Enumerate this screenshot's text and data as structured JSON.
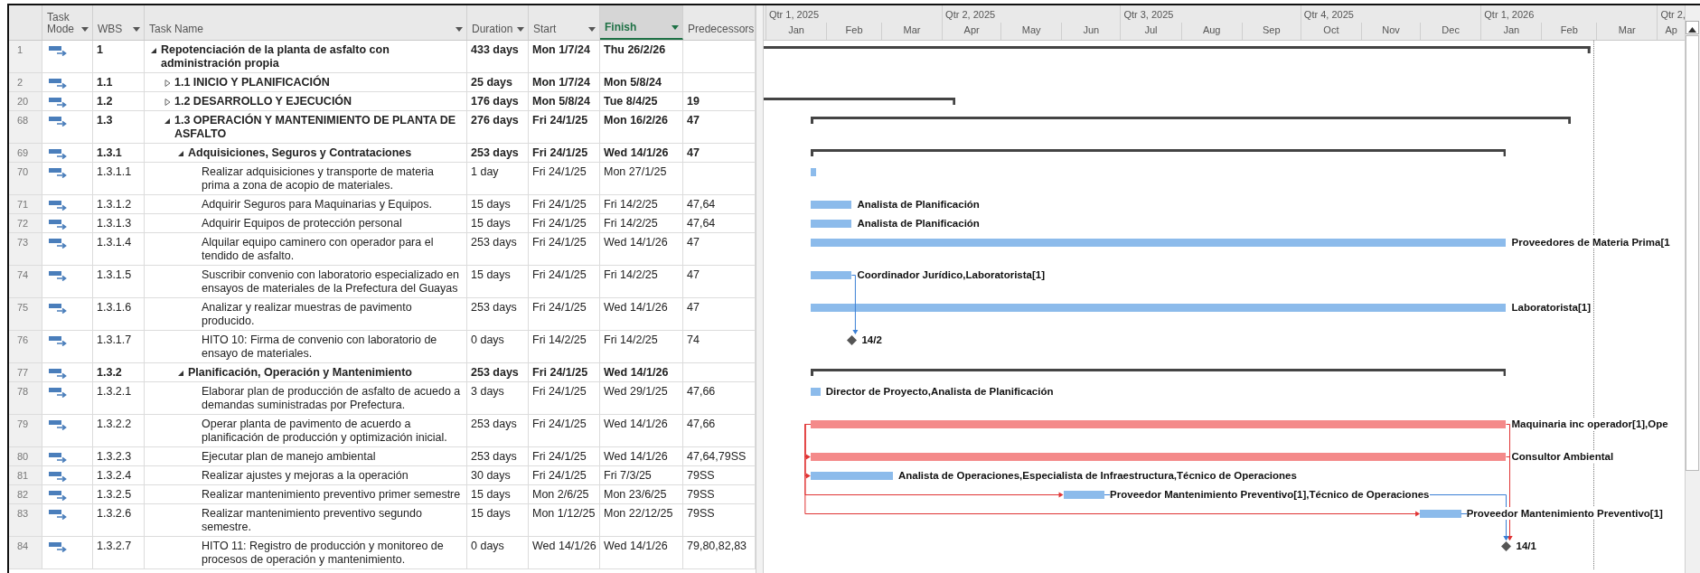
{
  "header": {
    "columns": [
      {
        "label": "Task Mode",
        "has_menu": true,
        "selected": false
      },
      {
        "label": "WBS",
        "has_menu": true,
        "selected": false
      },
      {
        "label": "Task Name",
        "has_menu": true,
        "selected": false
      },
      {
        "label": "Duration",
        "has_menu": true,
        "selected": false
      },
      {
        "label": "Start",
        "has_menu": true,
        "selected": false
      },
      {
        "label": "Finish",
        "has_menu": true,
        "selected": true
      },
      {
        "label": "Predecessors",
        "has_menu": false,
        "selected": false
      }
    ]
  },
  "timeline": {
    "quarters": [
      "Qtr 1, 2025",
      "Qtr 2, 2025",
      "Qtr 3, 2025",
      "Qtr 4, 2025",
      "Qtr 1, 2026",
      "Qtr 2,"
    ],
    "months": [
      "Jan",
      "Feb",
      "Mar",
      "Apr",
      "May",
      "Jun",
      "Jul",
      "Aug",
      "Sep",
      "Oct",
      "Nov",
      "Dec",
      "Jan",
      "Feb",
      "Mar",
      "Ap"
    ]
  },
  "tasks": [
    {
      "id": "1",
      "wbs": "1",
      "name": "Repotenciación de la planta de asfalto con administración propia",
      "duration": "433 days",
      "start": "Mon 1/7/24",
      "finish": "Thu 26/2/26",
      "kind": "summary",
      "expanded": true,
      "children": [
        {
          "id": "2",
          "wbs": "1.1",
          "name": "1.1 INICIO Y PLANIFICACIÓN",
          "duration": "25 days",
          "start": "Mon 1/7/24",
          "finish": "Mon 5/8/24",
          "kind": "summary",
          "expanded": false
        },
        {
          "id": "20",
          "wbs": "1.2",
          "name": "1.2 DESARROLLO Y EJECUCIÓN",
          "duration": "176 days",
          "start": "Mon 5/8/24",
          "finish": "Tue 8/4/25",
          "predecessors": "19",
          "kind": "summary",
          "expanded": false
        },
        {
          "id": "68",
          "wbs": "1.3",
          "name": "1.3 OPERACIÓN Y MANTENIMIENTO DE PLANTA DE ASFALTO",
          "duration": "276 days",
          "start": "Fri 24/1/25",
          "finish": "Mon 16/2/26",
          "predecessors": "47",
          "kind": "summary",
          "expanded": true,
          "children": [
            {
              "id": "69",
              "wbs": "1.3.1",
              "name": "Adquisiciones, Seguros y Contrataciones",
              "duration": "253 days",
              "start": "Fri 24/1/25",
              "finish": "Wed 14/1/26",
              "predecessors": "47",
              "kind": "summary",
              "expanded": true,
              "children": [
                {
                  "id": "70",
                  "wbs": "1.3.1.1",
                  "name": "Realizar adquisiciones y transporte de materia prima a zona de acopio de materiales.",
                  "duration": "1 day",
                  "start": "Fri 24/1/25",
                  "finish": "Mon 27/1/25",
                  "kind": "task",
                  "critical": false
                },
                {
                  "id": "71",
                  "wbs": "1.3.1.2",
                  "name": "Adquirir Seguros para Maquinarias y Equipos.",
                  "duration": "15 days",
                  "start": "Fri 24/1/25",
                  "finish": "Fri 14/2/25",
                  "predecessors": "47,64",
                  "kind": "task",
                  "critical": false,
                  "bar_label": "Analista de Planificación"
                },
                {
                  "id": "72",
                  "wbs": "1.3.1.3",
                  "name": "Adquirir Equipos de protección personal",
                  "duration": "15 days",
                  "start": "Fri 24/1/25",
                  "finish": "Fri 14/2/25",
                  "predecessors": "47,64",
                  "kind": "task",
                  "critical": false,
                  "bar_label": "Analista de Planificación"
                },
                {
                  "id": "73",
                  "wbs": "1.3.1.4",
                  "name": "Alquilar equipo caminero con operador para el tendido de asfalto.",
                  "duration": "253 days",
                  "start": "Fri 24/1/25",
                  "finish": "Wed 14/1/26",
                  "predecessors": "47",
                  "kind": "task",
                  "critical": false,
                  "bar_label": "Proveedores de Materia Prima[1"
                },
                {
                  "id": "74",
                  "wbs": "1.3.1.5",
                  "name": "Suscribir convenio con laboratorio especializado en ensayos de materiales de la Prefectura del Guayas",
                  "duration": "15 days",
                  "start": "Fri 24/1/25",
                  "finish": "Fri 14/2/25",
                  "predecessors": "47",
                  "kind": "task",
                  "critical": false,
                  "bar_label": "Coordinador Jurídico,Laboratorista[1]"
                },
                {
                  "id": "75",
                  "wbs": "1.3.1.6",
                  "name": "Analizar y realizar muestras de pavimento producido.",
                  "duration": "253 days",
                  "start": "Fri 24/1/25",
                  "finish": "Wed 14/1/26",
                  "predecessors": "47",
                  "kind": "task",
                  "critical": false,
                  "bar_label": "Laboratorista[1]"
                },
                {
                  "id": "76",
                  "wbs": "1.3.1.7",
                  "name": "HITO 10: Firma de convenio con laboratorio de ensayo de materiales.",
                  "duration": "0 days",
                  "start": "Fri 14/2/25",
                  "finish": "Fri 14/2/25",
                  "predecessors": "74",
                  "kind": "milestone",
                  "bar_label": "14/2"
                }
              ]
            },
            {
              "id": "77",
              "wbs": "1.3.2",
              "name": "Planificación, Operación y Mantenimiento",
              "duration": "253 days",
              "start": "Fri 24/1/25",
              "finish": "Wed 14/1/26",
              "kind": "summary",
              "expanded": true,
              "children": [
                {
                  "id": "78",
                  "wbs": "1.3.2.1",
                  "name": "Elaborar plan de producción de asfalto de acuedo a demandas suministradas por Prefectura.",
                  "duration": "3 days",
                  "start": "Fri 24/1/25",
                  "finish": "Wed 29/1/25",
                  "predecessors": "47,66",
                  "kind": "task",
                  "critical": false,
                  "bar_label": "Director de Proyecto,Analista de Planificación"
                },
                {
                  "id": "79",
                  "wbs": "1.3.2.2",
                  "name": "Operar planta de pavimento de acuerdo a planificación de producción y optimización inicial.",
                  "duration": "253 days",
                  "start": "Fri 24/1/25",
                  "finish": "Wed 14/1/26",
                  "predecessors": "47,66",
                  "kind": "task",
                  "critical": true,
                  "bar_label": "Maquinaria inc operador[1],Ope"
                },
                {
                  "id": "80",
                  "wbs": "1.3.2.3",
                  "name": "Ejecutar plan de manejo ambiental",
                  "duration": "253 days",
                  "start": "Fri 24/1/25",
                  "finish": "Wed 14/1/26",
                  "predecessors": "47,64,79SS",
                  "kind": "task",
                  "critical": true,
                  "bar_label": "Consultor Ambiental"
                },
                {
                  "id": "81",
                  "wbs": "1.3.2.4",
                  "name": "Realizar ajustes y mejoras a la operación",
                  "duration": "30 days",
                  "start": "Fri 24/1/25",
                  "finish": "Fri 7/3/25",
                  "predecessors": "79SS",
                  "kind": "task",
                  "critical": false,
                  "bar_label": "Analista de Operaciones,Especialista de Infraestructura,Técnico de Operaciones"
                },
                {
                  "id": "82",
                  "wbs": "1.3.2.5",
                  "name": "Realizar mantenimiento preventivo primer semestre",
                  "duration": "15 days",
                  "start": "Mon 2/6/25",
                  "finish": "Mon 23/6/25",
                  "predecessors": "79SS",
                  "kind": "task",
                  "critical": false,
                  "bar_label": "Proveedor Mantenimiento Preventivo[1],Técnico de Operaciones"
                },
                {
                  "id": "83",
                  "wbs": "1.3.2.6",
                  "name": "Realizar mantenimiento preventivo segundo semestre.",
                  "duration": "15 days",
                  "start": "Mon 1/12/25",
                  "finish": "Mon 22/12/25",
                  "predecessors": "79SS",
                  "kind": "task",
                  "critical": false,
                  "bar_label": "Proveedor Mantenimiento Preventivo[1]"
                },
                {
                  "id": "84",
                  "wbs": "1.3.2.7",
                  "name": "HITO 11: Registro de producción y monitoreo de procesos de operación y mantenimiento.",
                  "duration": "0 days",
                  "start": "Wed 14/1/26",
                  "finish": "Wed 14/1/26",
                  "predecessors": "79,80,82,83",
                  "kind": "milestone",
                  "bar_label": "14/1"
                }
              ]
            }
          ]
        }
      ]
    }
  ]
}
